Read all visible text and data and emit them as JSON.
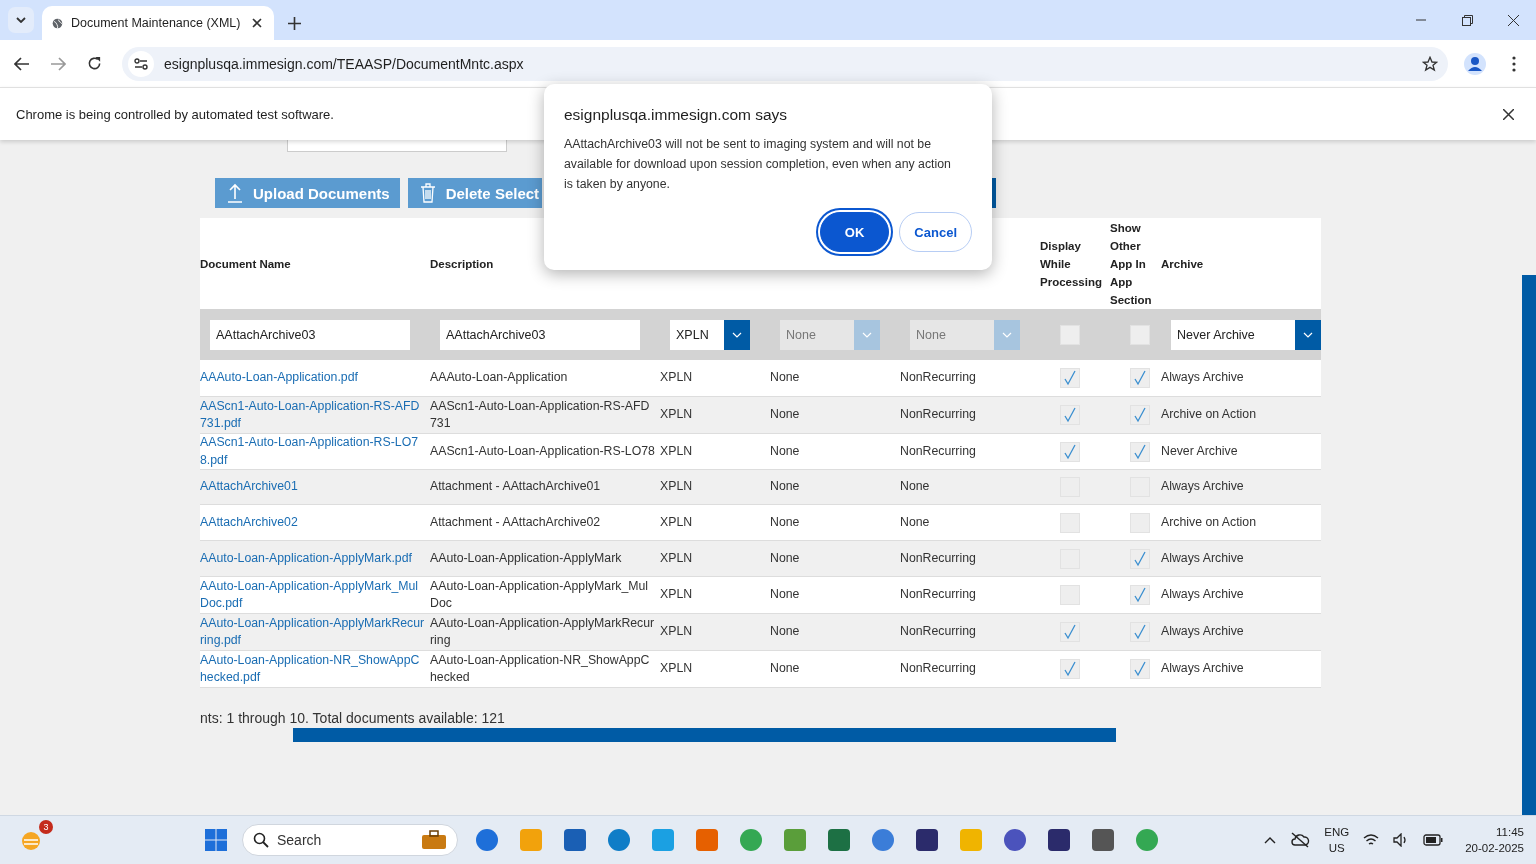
{
  "browser": {
    "tab_title": "Document Maintenance (XML)",
    "url": "esignplusqa.immesign.com/TEAASP/DocumentMntc.aspx",
    "infobar": "Chrome is being controlled by automated test software."
  },
  "toolbar": {
    "buttons": [
      "Upload Documents",
      "Delete Select"
    ]
  },
  "table": {
    "headers": [
      "Document Name",
      "Description",
      "Display While Processing",
      "Show Other App In App Section",
      "Archive"
    ],
    "filter": {
      "name": "AAttachArchive03",
      "description": "AAttachArchive03",
      "type": {
        "value": "XPLN",
        "disabled": false
      },
      "col4": {
        "value": "None",
        "disabled": true
      },
      "col5": {
        "value": "None",
        "disabled": true
      },
      "display": {
        "checked": false
      },
      "show_other": {
        "checked": false
      },
      "archive": {
        "value": "Never Archive",
        "disabled": false
      }
    },
    "rows": [
      {
        "name": "AAAuto-Loan-Application.pdf",
        "description": "AAAuto-Loan-Application",
        "type": "XPLN",
        "col4": "None",
        "col5": "NonRecurring",
        "display": true,
        "show_other": true,
        "archive": "Always Archive"
      },
      {
        "name": "AAScn1-Auto-Loan-Application-RS-AFD731.pdf",
        "description": "AAScn1-Auto-Loan-Application-RS-AFD731",
        "type": "XPLN",
        "col4": "None",
        "col5": "NonRecurring",
        "display": true,
        "show_other": true,
        "archive": "Archive on Action"
      },
      {
        "name": "AAScn1-Auto-Loan-Application-RS-LO78.pdf",
        "description": "AAScn1-Auto-Loan-Application-RS-LO78",
        "type": "XPLN",
        "col4": "None",
        "col5": "NonRecurring",
        "display": true,
        "show_other": true,
        "archive": "Never Archive"
      },
      {
        "name": "AAttachArchive01",
        "description": "Attachment - AAttachArchive01",
        "type": "XPLN",
        "col4": "None",
        "col5": "None",
        "display": false,
        "show_other": false,
        "archive": "Always Archive"
      },
      {
        "name": "AAttachArchive02",
        "description": "Attachment - AAttachArchive02",
        "type": "XPLN",
        "col4": "None",
        "col5": "None",
        "display": false,
        "show_other": false,
        "archive": "Archive on Action"
      },
      {
        "name": "AAuto-Loan-Application-ApplyMark.pdf",
        "description": "AAuto-Loan-Application-ApplyMark",
        "type": "XPLN",
        "col4": "None",
        "col5": "NonRecurring",
        "display": false,
        "show_other": true,
        "archive": "Always Archive"
      },
      {
        "name": "AAuto-Loan-Application-ApplyMark_MulDoc.pdf",
        "description": "AAuto-Loan-Application-ApplyMark_MulDoc",
        "type": "XPLN",
        "col4": "None",
        "col5": "NonRecurring",
        "display": false,
        "show_other": true,
        "archive": "Always Archive"
      },
      {
        "name": "AAuto-Loan-Application-ApplyMarkRecurring.pdf",
        "description": "AAuto-Loan-Application-ApplyMarkRecurring",
        "type": "XPLN",
        "col4": "None",
        "col5": "NonRecurring",
        "display": true,
        "show_other": true,
        "archive": "Always Archive"
      },
      {
        "name": "AAuto-Loan-Application-NR_ShowAppChecked.pdf",
        "description": "AAuto-Loan-Application-NR_ShowAppChecked",
        "type": "XPLN",
        "col4": "None",
        "col5": "NonRecurring",
        "display": true,
        "show_other": true,
        "archive": "Always Archive"
      }
    ],
    "footer": "nts: 1 through 10. Total documents available: 121"
  },
  "dialog": {
    "title": "esignplusqa.immesign.com says",
    "message": "AAttachArchive03 will not be sent to imaging system and will not be available for download upon session completion, even when any action is taken by anyone.",
    "buttons": [
      {
        "label": "OK",
        "selected": true
      },
      {
        "label": "Cancel",
        "selected": false
      }
    ]
  },
  "taskbar": {
    "badge": "3",
    "search": "Search",
    "language": "ENG",
    "region": "US",
    "time": "11:45",
    "date": "20-02-2025"
  }
}
